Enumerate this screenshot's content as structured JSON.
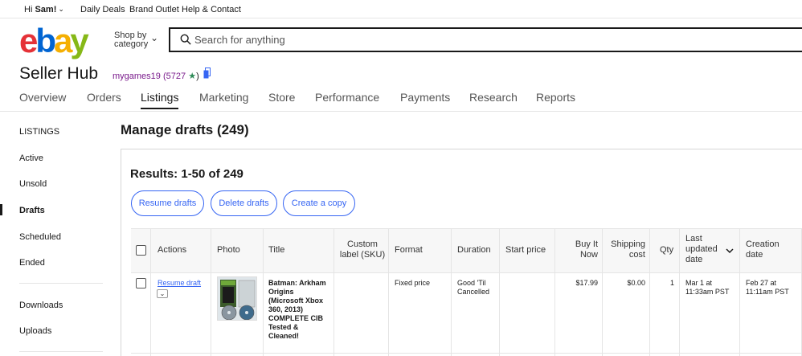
{
  "topbar": {
    "greeting_prefix": "Hi",
    "user_name": "Sam!",
    "links": [
      "Daily Deals",
      "Brand Outlet",
      "Help & Contact"
    ]
  },
  "header": {
    "logo_text": "ebay",
    "shop_by_line1": "Shop by",
    "shop_by_line2": "category",
    "search_placeholder": "Search for anything"
  },
  "seller": {
    "title": "Seller Hub",
    "username": "mygames19",
    "feedback_score": "(5727",
    "star": "★",
    "close_paren": ")"
  },
  "tabs": [
    "Overview",
    "Orders",
    "Listings",
    "Marketing",
    "Store",
    "Performance",
    "Payments",
    "Research",
    "Reports"
  ],
  "active_tab": "Listings",
  "sidebar": {
    "heading": "LISTINGS",
    "items": [
      "Active",
      "Unsold",
      "Drafts",
      "Scheduled",
      "Ended"
    ],
    "active_item": "Drafts",
    "secondary_items": [
      "Downloads",
      "Uploads"
    ]
  },
  "main": {
    "page_title": "Manage drafts (249)",
    "results_label": "Results: 1-50 of 249",
    "buttons": [
      "Resume drafts",
      "Delete drafts",
      "Create a copy"
    ]
  },
  "table": {
    "headers": {
      "actions": "Actions",
      "photo": "Photo",
      "title": "Title",
      "custom_label_1": "Custom",
      "custom_label_2": "label (SKU)",
      "format": "Format",
      "duration": "Duration",
      "start_price": "Start price",
      "buy_it_now_1": "Buy It",
      "buy_it_now_2": "Now",
      "shipping_1": "Shipping",
      "shipping_2": "cost",
      "qty": "Qty",
      "last_updated_1": "Last",
      "last_updated_2": "updated",
      "last_updated_3": "date",
      "creation_1": "Creation",
      "creation_2": "date"
    },
    "rows": [
      {
        "action": "Resume draft",
        "title_lines": [
          "Batman: Arkham",
          "Origins",
          "(Microsoft Xbox",
          "360, 2013)",
          "COMPLETE CIB",
          "Tested &",
          "Cleaned!"
        ],
        "custom_label": "",
        "format": "Fixed price",
        "duration_1": "Good 'Til",
        "duration_2": "Cancelled",
        "start_price": "",
        "buy_it_now": "$17.99",
        "shipping": "$0.00",
        "qty": "1",
        "last_updated_1": "Mar 1 at",
        "last_updated_2": "11:33am PST",
        "created_1": "Feb 27 at",
        "created_2": "11:11am PST"
      }
    ]
  }
}
